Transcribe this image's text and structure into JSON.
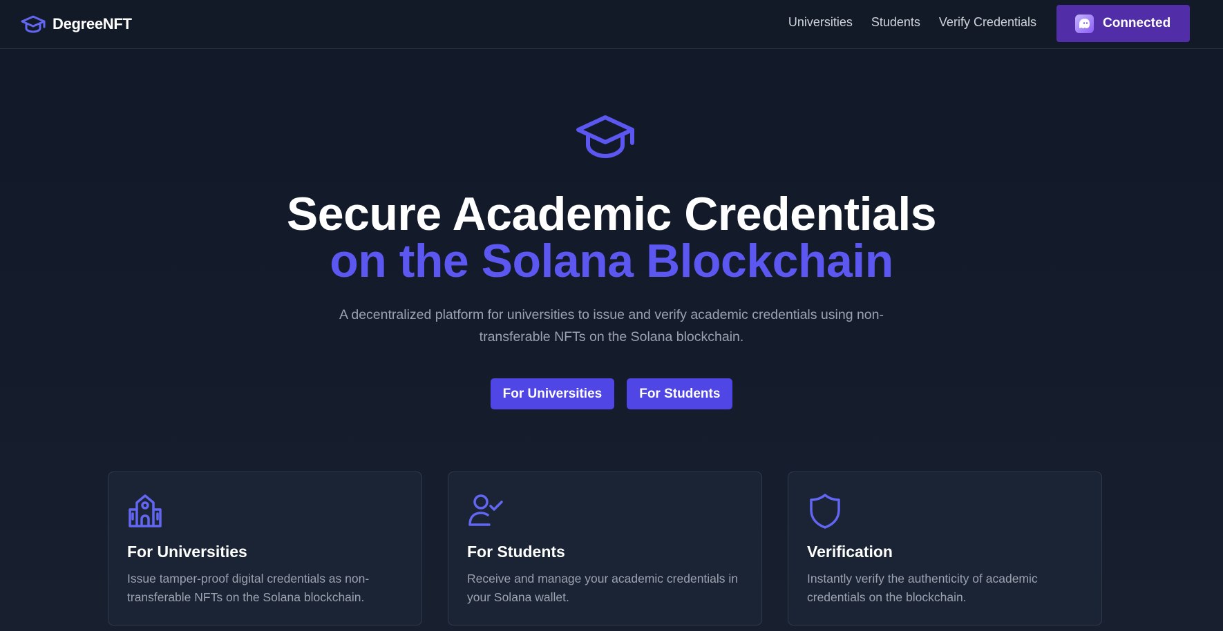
{
  "header": {
    "brand_name": "DegreeNFT",
    "brand_icon": "graduation-cap-icon",
    "nav": [
      {
        "label": "Universities"
      },
      {
        "label": "Students"
      },
      {
        "label": "Verify Credentials"
      }
    ],
    "wallet_button": {
      "label": "Connected",
      "icon": "phantom-ghost-icon",
      "color": "#512da8"
    }
  },
  "hero": {
    "icon": "graduation-cap-icon",
    "title_line1": "Secure Academic Credentials",
    "title_line2": "on the Solana Blockchain",
    "subtitle": "A decentralized platform for universities to issue and verify academic credentials using non-transferable NFTs on the Solana blockchain.",
    "buttons": [
      {
        "label": "For Universities"
      },
      {
        "label": "For Students"
      }
    ]
  },
  "features": [
    {
      "icon": "school-building-icon",
      "title": "For Universities",
      "description": "Issue tamper-proof digital credentials as non-transferable NFTs on the Solana blockchain."
    },
    {
      "icon": "user-check-icon",
      "title": "For Students",
      "description": "Receive and manage your academic credentials in your Solana wallet."
    },
    {
      "icon": "shield-icon",
      "title": "Verification",
      "description": "Instantly verify the authenticity of academic credentials on the blockchain."
    }
  ],
  "colors": {
    "accent": "#5b57f0",
    "button": "#4f46e5",
    "background": "#111827"
  }
}
